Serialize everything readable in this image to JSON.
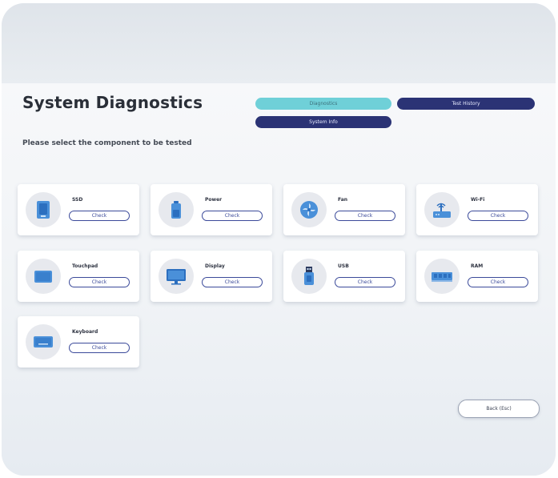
{
  "header": {
    "title": "System Diagnostics",
    "subtitle": "Please select the component to be tested"
  },
  "modes": [
    {
      "label": "Diagnostics",
      "state": "active"
    },
    {
      "label": "Test History",
      "state": "inactive"
    },
    {
      "label": "System Info",
      "state": "inactive"
    }
  ],
  "components": [
    {
      "label": "SSD",
      "icon": "ssd-icon",
      "check": "Check"
    },
    {
      "label": "Power",
      "icon": "battery-icon",
      "check": "Check"
    },
    {
      "label": "Fan",
      "icon": "fan-icon",
      "check": "Check"
    },
    {
      "label": "Wi-Fi",
      "icon": "wifi-router-icon",
      "check": "Check"
    },
    {
      "label": "Touchpad",
      "icon": "touchpad-icon",
      "check": "Check"
    },
    {
      "label": "Display",
      "icon": "display-icon",
      "check": "Check"
    },
    {
      "label": "USB",
      "icon": "usb-icon",
      "check": "Check"
    },
    {
      "label": "RAM",
      "icon": "ram-icon",
      "check": "Check"
    },
    {
      "label": "Keyboard",
      "icon": "keyboard-icon",
      "check": "Check"
    }
  ],
  "footer": {
    "back_label": "Back (Esc)"
  },
  "colors": {
    "accent_active": "#6fd0d8",
    "accent_dark": "#2b3375",
    "icon_blue": "#4a90d9",
    "outline_blue": "#3b4a9a"
  }
}
